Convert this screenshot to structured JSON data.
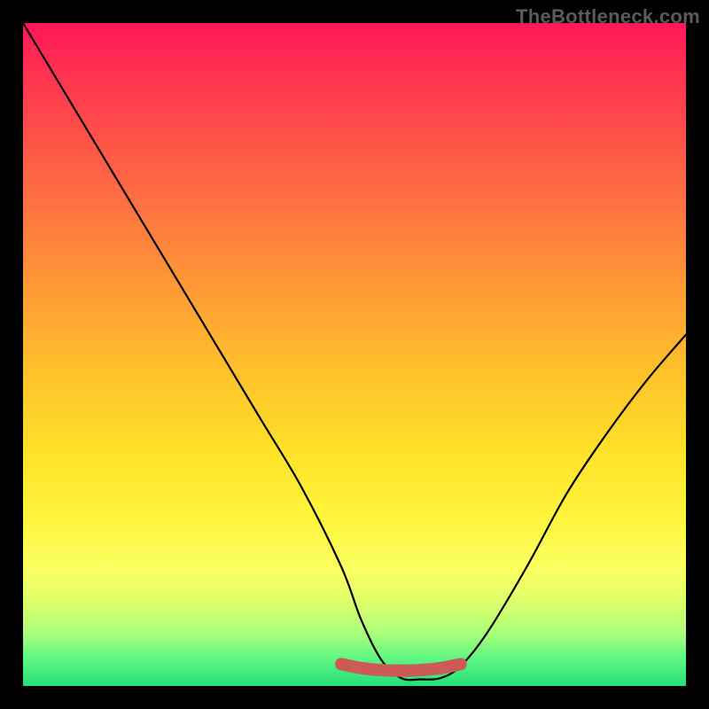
{
  "watermark": "TheBottleneck.com",
  "chart_data": {
    "type": "line",
    "title": "",
    "xlabel": "",
    "ylabel": "",
    "xlim": [
      0,
      100
    ],
    "ylim": [
      0,
      100
    ],
    "series": [
      {
        "name": "curve",
        "x": [
          0,
          6,
          12,
          18,
          24,
          30,
          36,
          42,
          48,
          51,
          54,
          57,
          60,
          63,
          66,
          70,
          76,
          82,
          88,
          94,
          100
        ],
        "y": [
          100,
          90,
          80,
          70,
          60,
          50,
          40,
          30,
          18,
          10,
          4,
          1.2,
          1.0,
          1.2,
          3,
          8,
          18,
          29,
          38,
          46,
          53
        ]
      },
      {
        "name": "marker-band",
        "x": [
          48,
          51,
          54,
          57,
          60,
          63,
          66
        ],
        "y": [
          3.3,
          2.7,
          2.4,
          2.3,
          2.4,
          2.7,
          3.3
        ]
      }
    ],
    "gradient_stops": [
      {
        "pos": 0.0,
        "color": "#ff1858"
      },
      {
        "pos": 0.08,
        "color": "#ff3450"
      },
      {
        "pos": 0.2,
        "color": "#ff5a47"
      },
      {
        "pos": 0.35,
        "color": "#ff8a3a"
      },
      {
        "pos": 0.52,
        "color": "#ffbf2c"
      },
      {
        "pos": 0.64,
        "color": "#ffe028"
      },
      {
        "pos": 0.74,
        "color": "#fff43a"
      },
      {
        "pos": 0.82,
        "color": "#faff5f"
      },
      {
        "pos": 0.87,
        "color": "#e1ff6a"
      },
      {
        "pos": 0.92,
        "color": "#aaff7a"
      },
      {
        "pos": 0.96,
        "color": "#5cf682"
      },
      {
        "pos": 1.0,
        "color": "#23e07a"
      }
    ],
    "curve_color": "#000000",
    "marker_color": "#cc5a57"
  }
}
